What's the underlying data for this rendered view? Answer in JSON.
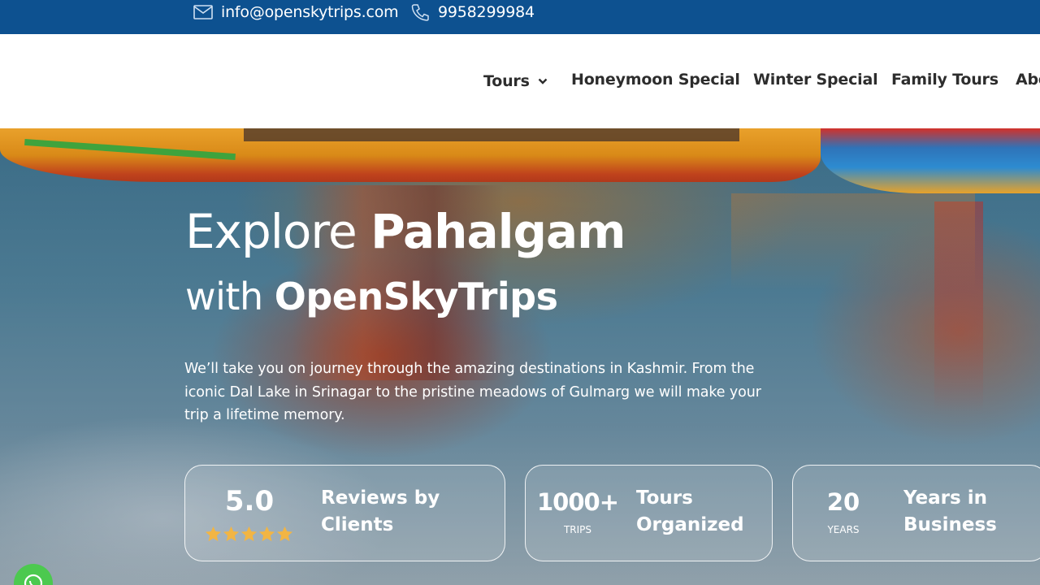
{
  "topbar": {
    "email": "info@openskytrips.com",
    "phone": "9958299984",
    "email_icon": "mail-icon",
    "phone_icon": "phone-icon"
  },
  "nav": {
    "items": [
      {
        "label": "Tours",
        "has_dropdown": true
      },
      {
        "label": "Honeymoon Special"
      },
      {
        "label": "Winter Special"
      },
      {
        "label": "Family Tours"
      },
      {
        "label": "Abo"
      }
    ]
  },
  "hero": {
    "title_line1_light": "Explore ",
    "title_line1_bold": "Pahalgam",
    "title_line2_light": "with ",
    "title_line2_bold": "OpenSkyTrips",
    "description": "We’ll take you on journey through the amazing destinations in Kashmir. From the iconic Dal Lake in Srinagar to the pristine meadows of Gulmarg we will make your trip a lifetime memory."
  },
  "stats": [
    {
      "value": "5.0",
      "sub": "",
      "label_line1": "Reviews by",
      "label_line2": "Clients",
      "rating": 5
    },
    {
      "value": "1000+",
      "sub": "TRIPS",
      "label_line1": "Tours",
      "label_line2": "Organized"
    },
    {
      "value": "20",
      "sub": "YEARS",
      "label_line1": "Years in",
      "label_line2": "Business"
    }
  ],
  "colors": {
    "topbar_bg": "#0d5190",
    "nav_text": "#2d2d2d",
    "star": "#f2b544",
    "whatsapp": "#4cc94f"
  }
}
